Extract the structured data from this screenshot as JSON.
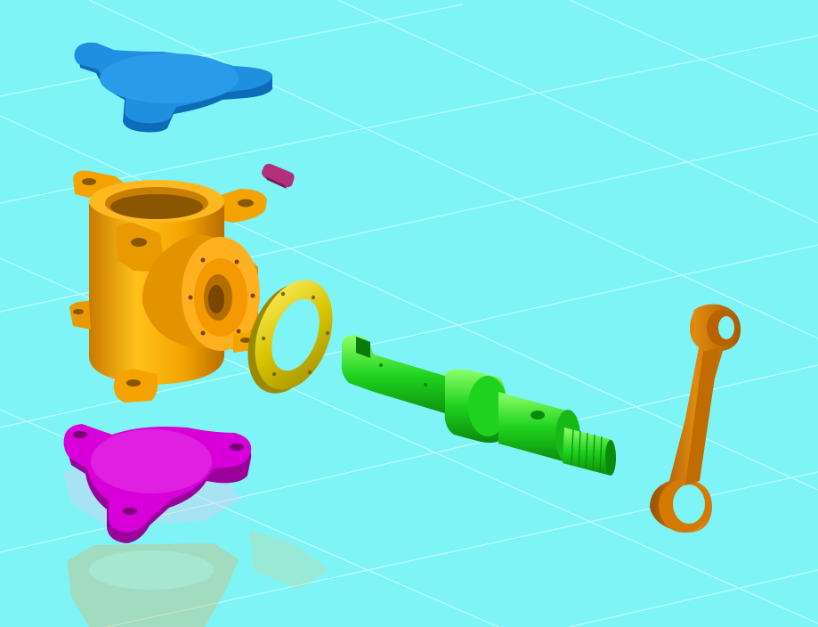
{
  "scene": {
    "background": "#7ff4f6",
    "grid_color": "#b9fbfb",
    "parts": [
      {
        "name": "top-flange-cover",
        "color": "#1f8fe0"
      },
      {
        "name": "pump-housing",
        "color": "#f4a300"
      },
      {
        "name": "key",
        "color": "#b0307a"
      },
      {
        "name": "bearing-ring",
        "color": "#d8c400"
      },
      {
        "name": "drive-shaft",
        "color": "#1ed21e"
      },
      {
        "name": "crank-arm",
        "color": "#d47a00"
      },
      {
        "name": "bottom-flange-cover",
        "color": "#d800d8"
      }
    ]
  }
}
